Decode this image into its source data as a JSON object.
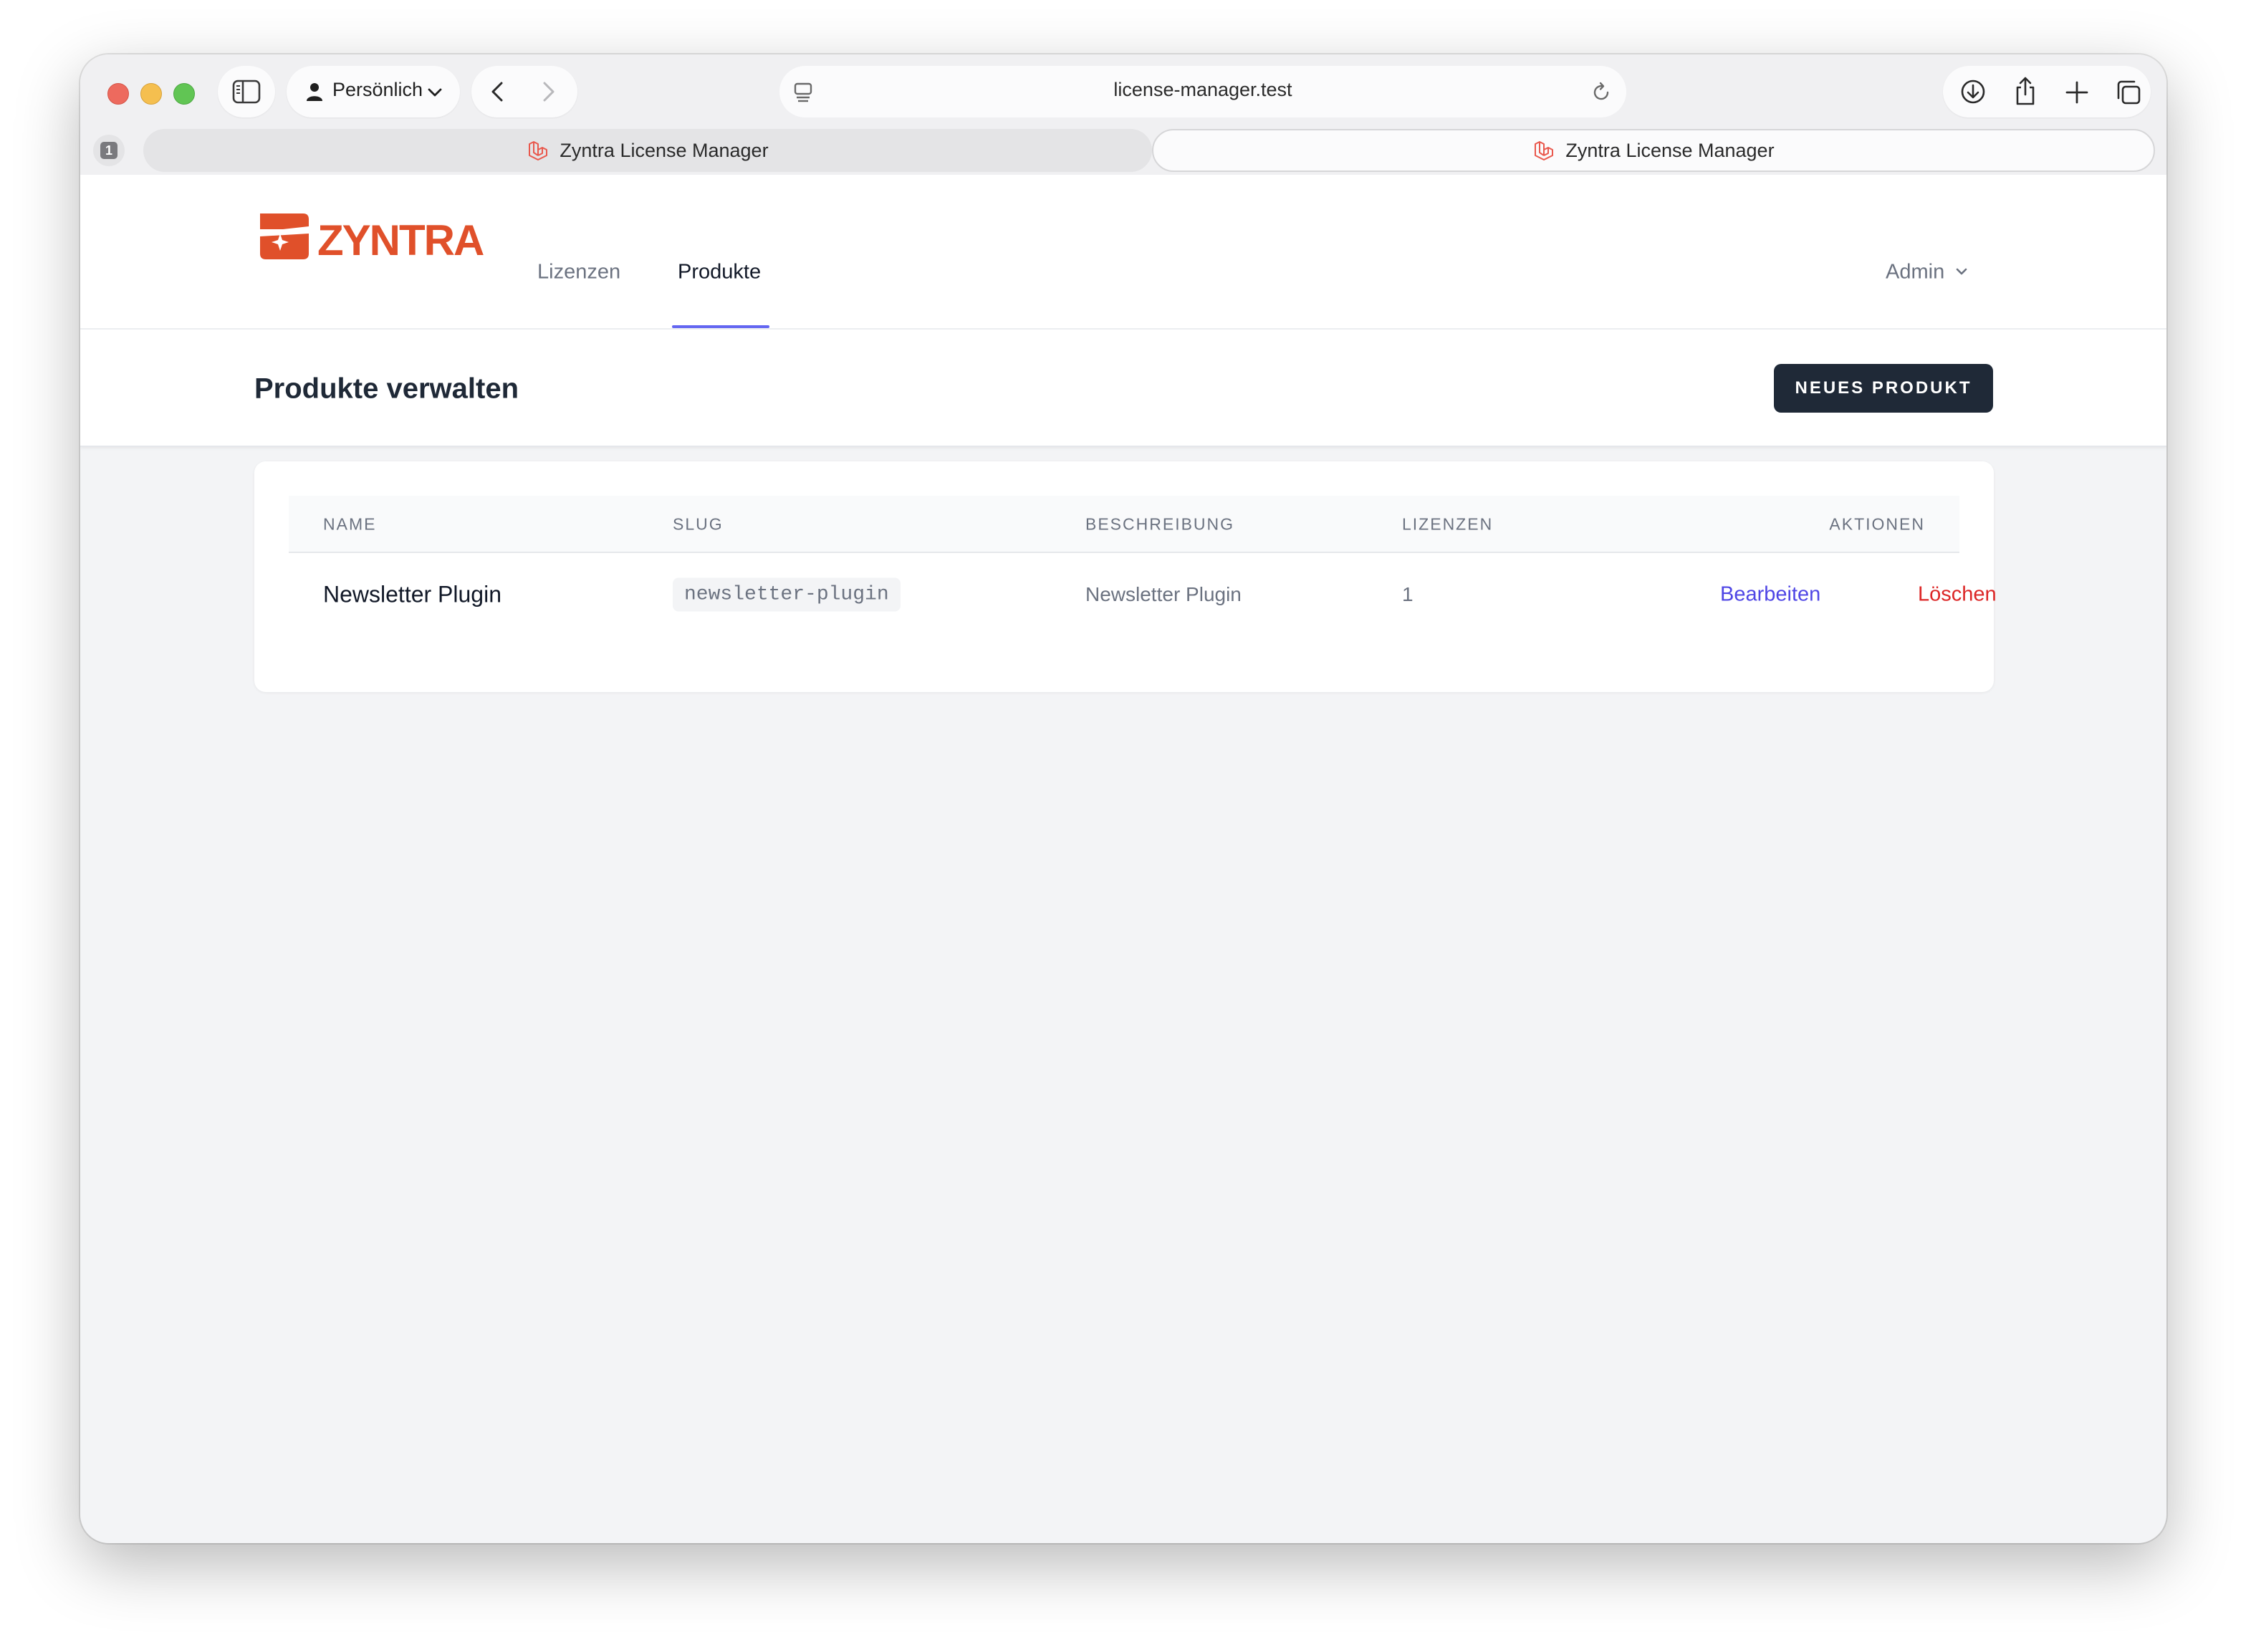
{
  "browser": {
    "profile_label": "Persönlich",
    "url": "license-manager.test",
    "tab_count": "1",
    "tabs": [
      {
        "title": "Zyntra License Manager",
        "icon": "laravel-icon"
      },
      {
        "title": "Zyntra License Manager",
        "icon": "laravel-icon"
      }
    ]
  },
  "nav": {
    "logo_text": "ZYNTRA",
    "links": [
      {
        "label": "Lizenzen"
      },
      {
        "label": "Produkte"
      }
    ],
    "user_menu_label": "Admin"
  },
  "header": {
    "title": "Produkte verwalten",
    "new_button_label": "NEUES PRODUKT"
  },
  "table": {
    "columns": [
      "NAME",
      "SLUG",
      "BESCHREIBUNG",
      "LIZENZEN",
      "AKTIONEN"
    ],
    "rows": [
      {
        "name": "Newsletter Plugin",
        "slug": "newsletter-plugin",
        "description": "Newsletter Plugin",
        "licenses": "1",
        "edit_label": "Bearbeiten",
        "delete_label": "Löschen"
      }
    ]
  },
  "colors": {
    "brand": "#e0502a",
    "primary_button": "#1f2937",
    "active_nav_underline": "#6366f1",
    "edit_link": "#4f46e5",
    "delete_link": "#dc2626"
  }
}
